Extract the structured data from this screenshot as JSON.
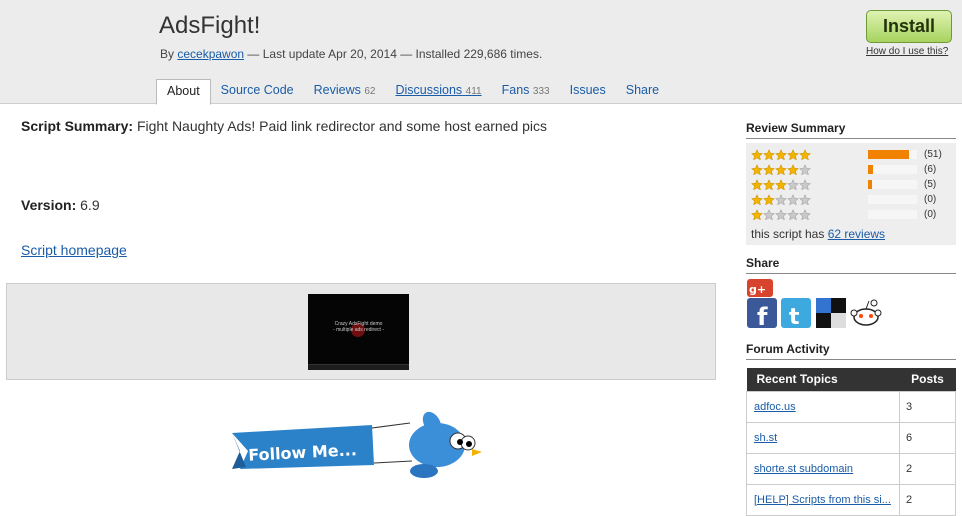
{
  "header": {
    "title": "AdsFight!",
    "by_prefix": "By",
    "author": "cecekpawon",
    "meta_suffix": "— Last update Apr 20, 2014 — Installed 229,686 times.",
    "install_label": "Install",
    "how_label": "How do I use this?"
  },
  "tabs": [
    {
      "label": "About",
      "count": ""
    },
    {
      "label": "Source Code",
      "count": ""
    },
    {
      "label": "Reviews",
      "count": "62"
    },
    {
      "label": "Discussions",
      "count": "411"
    },
    {
      "label": "Fans",
      "count": "333"
    },
    {
      "label": "Issues",
      "count": ""
    },
    {
      "label": "Share",
      "count": ""
    }
  ],
  "main": {
    "summary_label": "Script Summary:",
    "summary_text": "Fight Naughty Ads! Paid link redirector and some host earned pics",
    "version_label": "Version:",
    "version_value": "6.9",
    "homepage_label": "Script homepage",
    "video_line1": "Crazy AdsFight demo",
    "video_line2": "- multiple ads redirect -",
    "follow_text": "Follow Me..."
  },
  "sidebar": {
    "review_title": "Review Summary",
    "ratings": [
      {
        "stars": 5,
        "count": "(51)",
        "fraction": 0.84
      },
      {
        "stars": 4,
        "count": "(6)",
        "fraction": 0.1
      },
      {
        "stars": 3,
        "count": "(5)",
        "fraction": 0.08
      },
      {
        "stars": 2,
        "count": "(0)",
        "fraction": 0
      },
      {
        "stars": 1,
        "count": "(0)",
        "fraction": 0
      }
    ],
    "has_prefix": "this script has",
    "reviews_link": "62 reviews",
    "share_title": "Share",
    "share_icons": [
      "google-plus-icon",
      "facebook-icon",
      "twitter-icon",
      "delicious-icon",
      "reddit-icon"
    ],
    "forum_title": "Forum Activity",
    "forum_headers": {
      "topics": "Recent Topics",
      "posts": "Posts"
    },
    "topics": [
      {
        "title": "adfoc.us",
        "posts": "3"
      },
      {
        "title": "sh.st",
        "posts": "6"
      },
      {
        "title": "shorte.st subdomain",
        "posts": "2"
      },
      {
        "title": "[HELP] Scripts from this si...",
        "posts": "2"
      }
    ]
  },
  "colors": {
    "accent": "#1a5ca8",
    "install_green": "#a7d35f",
    "rating_bar": "#f08200",
    "star": "#f3b400"
  }
}
